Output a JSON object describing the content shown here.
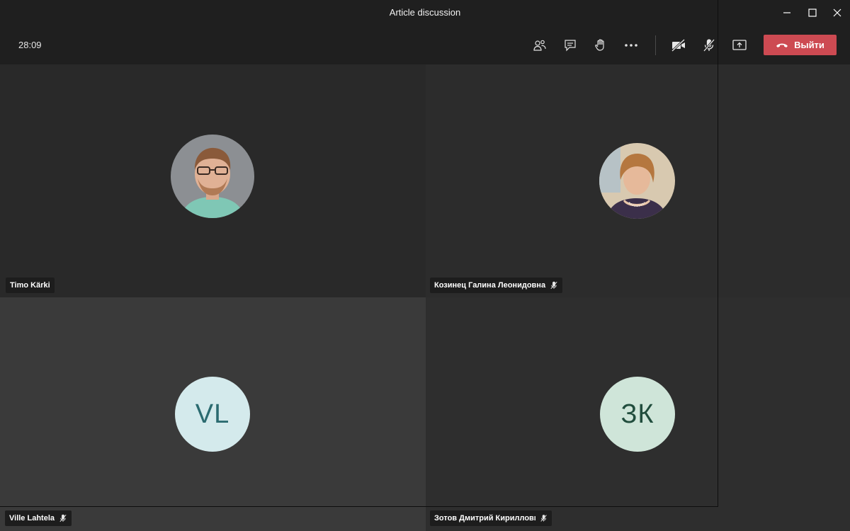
{
  "window": {
    "title": "Article discussion",
    "controls": [
      "minimize-icon",
      "maximize-icon",
      "close-icon"
    ]
  },
  "toolbar": {
    "timer": "28:09",
    "buttons": [
      "participants-icon",
      "chat-icon",
      "raise-hand-icon",
      "more-options-icon",
      "camera-off-icon",
      "mic-off-icon",
      "share-screen-icon"
    ],
    "leave_label": "Выйти",
    "leave_color": "#cd4a52"
  },
  "participants": [
    {
      "name": "Timo Kärki",
      "muted": false,
      "avatar": "photo"
    },
    {
      "name": "Козинец Галина Леонидовна",
      "muted": true,
      "avatar": "photo"
    },
    {
      "name": "Ville Lahtela",
      "muted": true,
      "initials": "VL",
      "avatar_bg": "#d4eaec",
      "initials_color": "#2b6b70"
    },
    {
      "name": "Зотов Дмитрий Кириллович",
      "muted": true,
      "initials": "ЗК",
      "avatar_bg": "#cfe5d9",
      "initials_color": "#214d3d"
    }
  ]
}
